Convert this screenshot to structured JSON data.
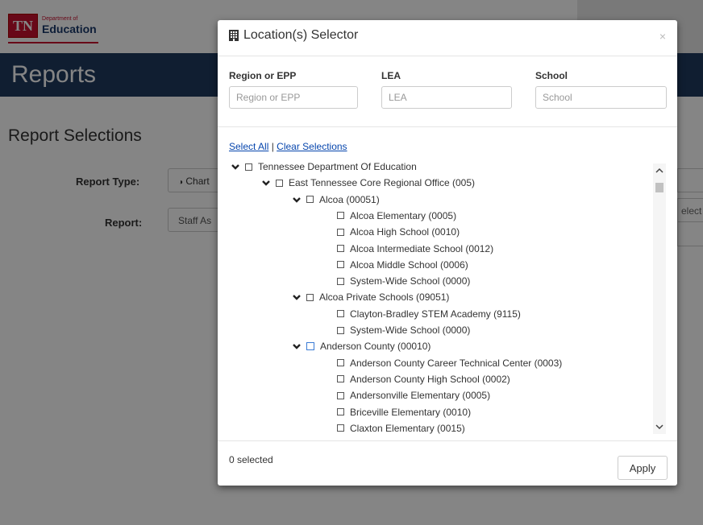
{
  "page": {
    "logo_abbr": "TN",
    "logo_small": "Department of",
    "logo_big": "Education",
    "banner_title": "Reports",
    "section_title": "Report Selections",
    "report_type_label": "Report Type:",
    "report_type_value": "Chart",
    "report_label": "Report:",
    "report_value": "Staff As",
    "right_input_text": "elect"
  },
  "modal": {
    "title": "Location(s) Selector",
    "close": "×",
    "filters": {
      "region_label": "Region or EPP",
      "region_placeholder": "Region or EPP",
      "lea_label": "LEA",
      "lea_placeholder": "LEA",
      "school_label": "School",
      "school_placeholder": "School"
    },
    "select_all": "Select All",
    "separator": "|",
    "clear_selections": "Clear Selections",
    "tree": [
      {
        "label": "Tennessee Department Of Education",
        "level": 0,
        "expanded": true
      },
      {
        "label": "East Tennessee Core Regional Office (005)",
        "level": 1,
        "expanded": true
      },
      {
        "label": "Alcoa (00051)",
        "level": 2,
        "expanded": true
      },
      {
        "label": "Alcoa Elementary (0005)",
        "level": 3
      },
      {
        "label": "Alcoa High School (0010)",
        "level": 3
      },
      {
        "label": "Alcoa Intermediate School (0012)",
        "level": 3
      },
      {
        "label": "Alcoa Middle School (0006)",
        "level": 3
      },
      {
        "label": "System-Wide School (0000)",
        "level": 3
      },
      {
        "label": "Alcoa Private Schools (09051)",
        "level": 2,
        "expanded": true
      },
      {
        "label": "Clayton-Bradley STEM Academy (9115)",
        "level": 3
      },
      {
        "label": "System-Wide School (0000)",
        "level": 3
      },
      {
        "label": "Anderson County (00010)",
        "level": 2,
        "expanded": true,
        "focused": true
      },
      {
        "label": "Anderson County Career Technical Center (0003)",
        "level": 3
      },
      {
        "label": "Anderson County High School (0002)",
        "level": 3
      },
      {
        "label": "Andersonville Elementary (0005)",
        "level": 3
      },
      {
        "label": "Briceville Elementary (0010)",
        "level": 3
      },
      {
        "label": "Claxton Elementary (0015)",
        "level": 3
      }
    ],
    "selected_count": "0 selected",
    "apply_label": "Apply"
  }
}
